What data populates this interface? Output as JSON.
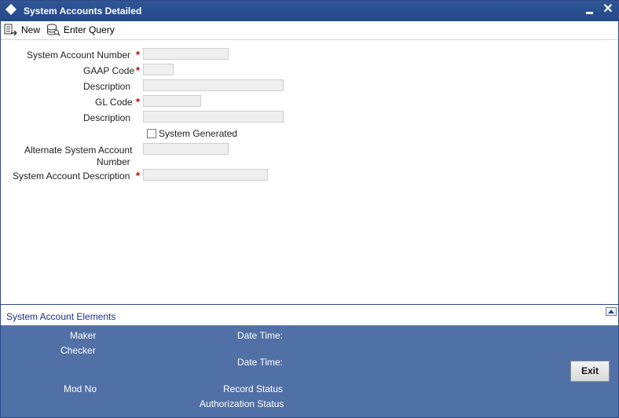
{
  "window": {
    "title": "System Accounts Detailed",
    "minimize_icon": "minimize-icon",
    "close_glyph": "✕"
  },
  "toolbar": {
    "new_label": "New",
    "enter_query_label": "Enter Query"
  },
  "form": {
    "system_account_number_label": "System Account Number",
    "gaap_code_label": "GAAP Code",
    "description_label": "Description",
    "gl_code_label": "GL Code",
    "gl_description_label": "Description",
    "system_generated_label": "System Generated",
    "alternate_label_line1": "Alternate System Account",
    "alternate_label_line2": "Number",
    "system_account_description_label": "System Account Description",
    "required_mark": "*",
    "values": {
      "system_account_number": "",
      "gaap_code": "",
      "description": "",
      "gl_code": "",
      "gl_description": "",
      "alternate_system_account_number": "",
      "system_account_description": ""
    },
    "system_generated_checked": false
  },
  "elements_section": {
    "link_label": "System Account Elements"
  },
  "footer": {
    "maker_label": "Maker",
    "checker_label": "Checker",
    "date_time_label_1": "Date Time:",
    "date_time_label_2": "Date Time:",
    "mod_no_label": "Mod No",
    "record_status_label": "Record Status",
    "authorization_status_label": "Authorization Status",
    "exit_label": "Exit"
  },
  "colors": {
    "title_bar": "#2f5597",
    "footer": "#5170a6",
    "required": "#c00000",
    "link": "#1a2f8a"
  }
}
